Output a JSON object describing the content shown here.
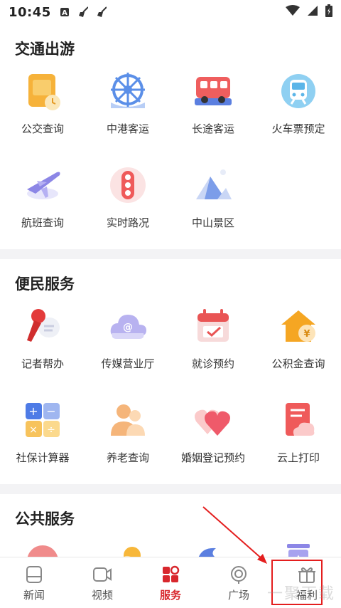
{
  "status_bar": {
    "time": "10:45",
    "icons": [
      "a-icon",
      "broom-icon",
      "broom-icon",
      "wifi-icon",
      "signal-icon",
      "battery-icon"
    ]
  },
  "sections": [
    {
      "title": "交通出游",
      "items": [
        {
          "label": "公交查询",
          "icon": "bus-card-icon"
        },
        {
          "label": "中港客运",
          "icon": "ship-wheel-icon"
        },
        {
          "label": "长途客运",
          "icon": "coach-icon"
        },
        {
          "label": "火车票预定",
          "icon": "train-icon"
        },
        {
          "label": "航班查询",
          "icon": "airplane-icon"
        },
        {
          "label": "实时路况",
          "icon": "traffic-light-icon"
        },
        {
          "label": "中山景区",
          "icon": "mountain-icon"
        }
      ]
    },
    {
      "title": "便民服务",
      "items": [
        {
          "label": "记者帮办",
          "icon": "microphone-icon"
        },
        {
          "label": "传媒营业厅",
          "icon": "cloud-at-icon"
        },
        {
          "label": "就诊预约",
          "icon": "calendar-icon"
        },
        {
          "label": "公积金查询",
          "icon": "house-yuan-icon"
        },
        {
          "label": "社保计算器",
          "icon": "calculator-icon"
        },
        {
          "label": "养老查询",
          "icon": "people-icon"
        },
        {
          "label": "婚姻登记预约",
          "icon": "hearts-icon"
        },
        {
          "label": "云上打印",
          "icon": "printer-icon"
        }
      ]
    },
    {
      "title": "公共服务",
      "items": [
        {
          "label": "",
          "icon": "weather-icon"
        },
        {
          "label": "",
          "icon": "cloud-icon"
        },
        {
          "label": "",
          "icon": "typhoon-icon"
        },
        {
          "label": "",
          "icon": "recycle-bin-icon"
        }
      ]
    }
  ],
  "tabs": [
    {
      "label": "新闻",
      "icon": "news-icon"
    },
    {
      "label": "视频",
      "icon": "video-icon"
    },
    {
      "label": "服务",
      "icon": "service-icon",
      "active": true
    },
    {
      "label": "广场",
      "icon": "plaza-icon"
    },
    {
      "label": "福利",
      "icon": "gift-icon"
    }
  ],
  "watermark": "一聚下载",
  "colors": {
    "accent": "#d8272d",
    "highlight": "#e41e1e",
    "divider": "#f3f3f5"
  }
}
